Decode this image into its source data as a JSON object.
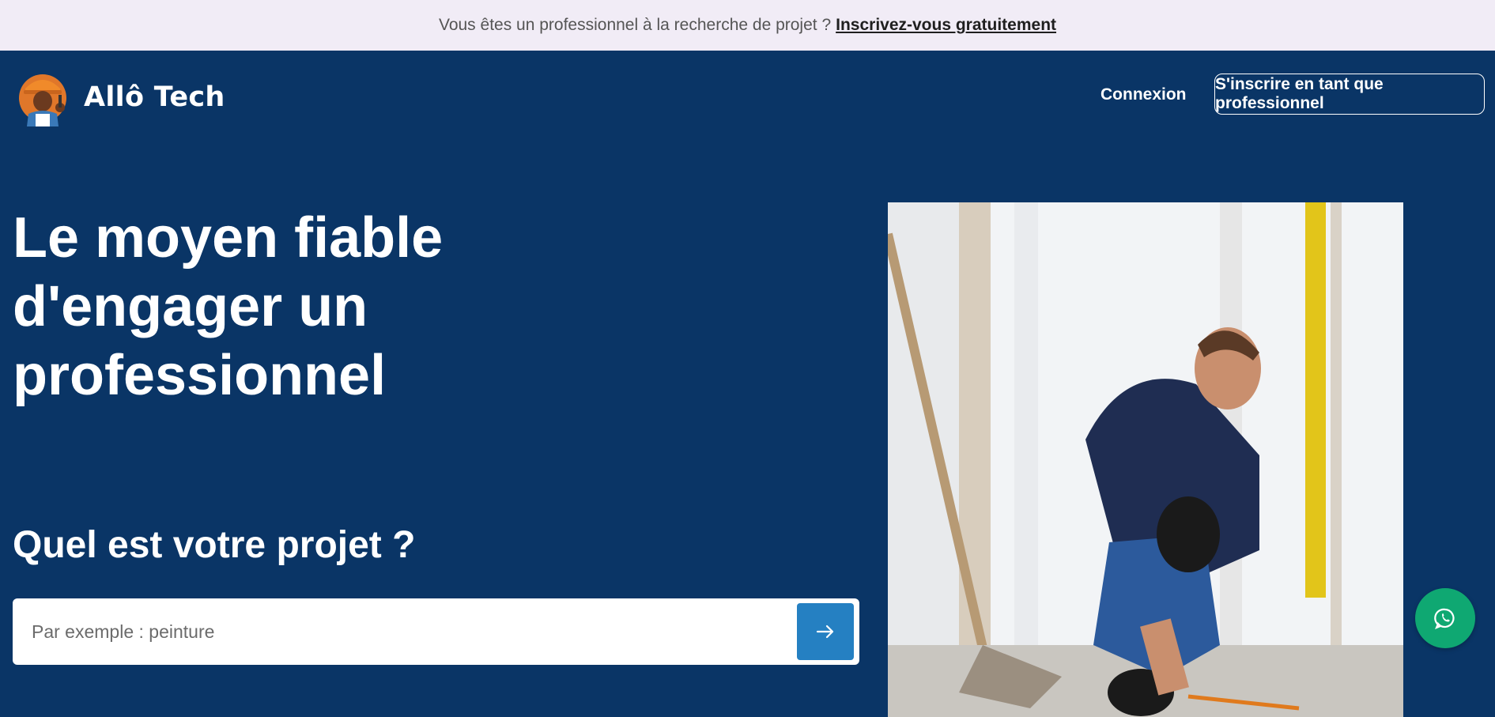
{
  "banner": {
    "text": "Vous êtes un professionnel à la recherche de projet ?",
    "link": "Inscrivez-vous gratuitement"
  },
  "header": {
    "brand": "Allô Tech",
    "login_label": "Connexion",
    "signup_label": "S'inscrire en tant que professionnel"
  },
  "hero": {
    "headline": "Le moyen fiable d'engager un professionnel",
    "subheadline": "Quel est votre projet ?",
    "search": {
      "placeholder": "Par exemple : peinture",
      "value": ""
    },
    "image_alt": "worker-photo"
  },
  "icons": {
    "logo": "mascot-logo-icon",
    "search_submit": "arrow-right-icon",
    "chat": "whatsapp-icon"
  },
  "colors": {
    "background": "#0a3566",
    "banner_bg": "#f1ecf6",
    "search_button": "#2580c2",
    "whatsapp": "#0fa872"
  }
}
